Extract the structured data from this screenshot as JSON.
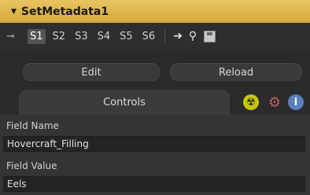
{
  "header": {
    "title": "SetMetadata1"
  },
  "toolbar": {
    "slots": [
      "S1",
      "S2",
      "S3",
      "S4",
      "S5",
      "S6"
    ],
    "active_slot": "S1"
  },
  "buttons": {
    "edit": "Edit",
    "reload": "Reload"
  },
  "tabs": {
    "controls": "Controls"
  },
  "fields": {
    "field_name_label": "Field Name",
    "field_name_value": "Hovercraft_Filling",
    "field_value_label": "Field Value",
    "field_value_value": "Eels"
  }
}
